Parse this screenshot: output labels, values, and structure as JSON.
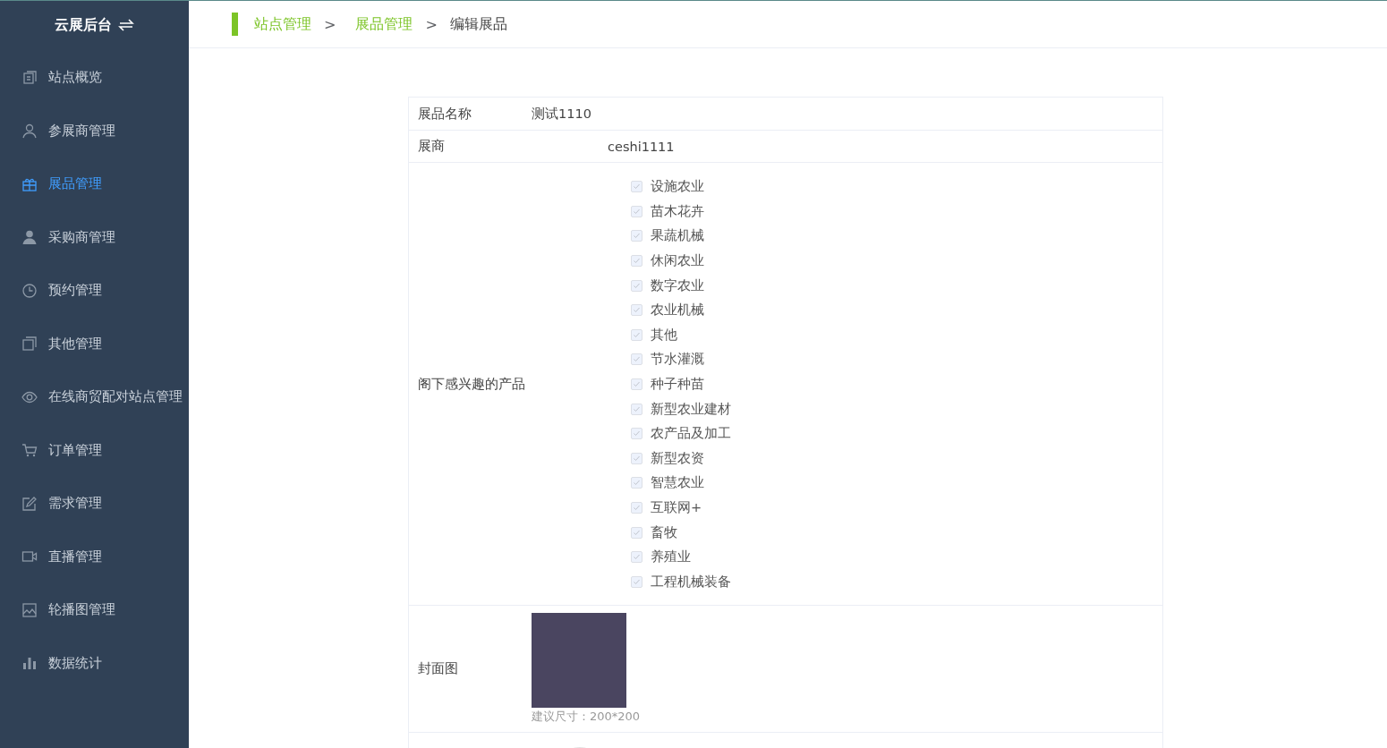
{
  "sidebar": {
    "title": "云展后台",
    "items": [
      {
        "label": "站点概览",
        "selected": false
      },
      {
        "label": "参展商管理",
        "selected": false
      },
      {
        "label": "展品管理",
        "selected": true
      },
      {
        "label": "采购商管理",
        "selected": false
      },
      {
        "label": "预约管理",
        "selected": false
      },
      {
        "label": "其他管理",
        "selected": false
      },
      {
        "label": "在线商贸配对站点管理",
        "selected": false
      },
      {
        "label": "订单管理",
        "selected": false
      },
      {
        "label": "需求管理",
        "selected": false
      },
      {
        "label": "直播管理",
        "selected": false
      },
      {
        "label": "轮播图管理",
        "selected": false
      },
      {
        "label": "数据统计",
        "selected": false
      }
    ]
  },
  "breadcrumb": [
    {
      "label": "站点管理",
      "kind": "link"
    },
    {
      "label": ">",
      "kind": "separator"
    },
    {
      "label": "展品管理",
      "kind": "link"
    },
    {
      "label": ">",
      "kind": "separator"
    },
    {
      "label": "编辑展品",
      "kind": "current"
    }
  ],
  "form": {
    "name": {
      "label": "展品名称",
      "value": "测试1110"
    },
    "exhibitor": {
      "label": "展商",
      "value": "ceshi1111"
    },
    "interests": {
      "label": "阁下感兴趣的产品",
      "options": [
        {
          "label": "设施农业",
          "checked": true,
          "disabled": true
        },
        {
          "label": "苗木花卉",
          "checked": true,
          "disabled": true
        },
        {
          "label": "果蔬机械",
          "checked": true,
          "disabled": true
        },
        {
          "label": "休闲农业",
          "checked": true,
          "disabled": true
        },
        {
          "label": "数字农业",
          "checked": true,
          "disabled": true
        },
        {
          "label": "农业机械",
          "checked": true,
          "disabled": true
        },
        {
          "label": "其他",
          "checked": true,
          "disabled": true
        },
        {
          "label": "节水灌溉",
          "checked": true,
          "disabled": true
        },
        {
          "label": "种子种苗",
          "checked": true,
          "disabled": true
        },
        {
          "label": "新型农业建材",
          "checked": true,
          "disabled": true
        },
        {
          "label": "农产品及加工",
          "checked": true,
          "disabled": true
        },
        {
          "label": "新型农资",
          "checked": true,
          "disabled": true
        },
        {
          "label": "智慧农业",
          "checked": true,
          "disabled": true
        },
        {
          "label": "互联网+",
          "checked": true,
          "disabled": true
        },
        {
          "label": "畜牧",
          "checked": true,
          "disabled": true
        },
        {
          "label": "养殖业",
          "checked": true,
          "disabled": true
        },
        {
          "label": "工程机械装备",
          "checked": true,
          "disabled": true
        }
      ]
    },
    "cover": {
      "label": "封面图",
      "hint": "建议尺寸：200*200"
    }
  }
}
